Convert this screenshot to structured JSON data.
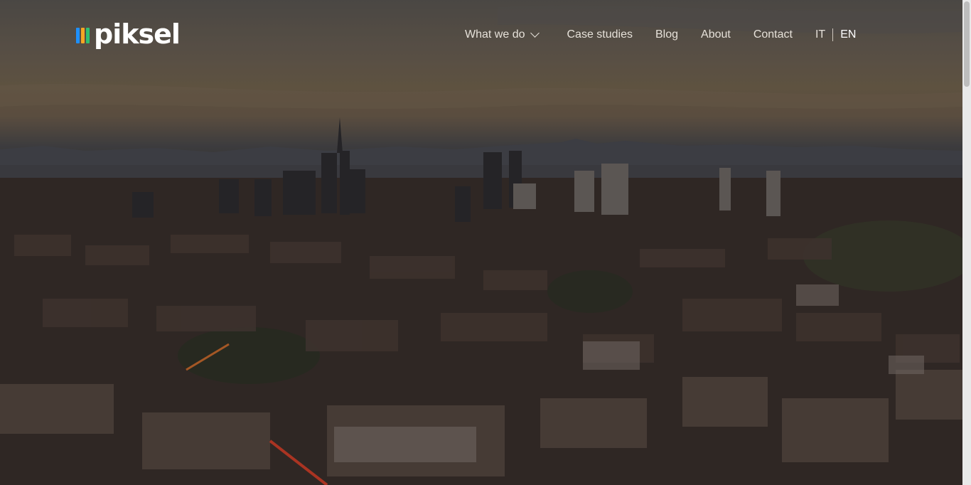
{
  "brand": {
    "name": "piksel",
    "mark_colors": [
      "#1e90ff",
      "#f5a623",
      "#2fbf71"
    ]
  },
  "nav": {
    "items": [
      {
        "label": "What we do",
        "has_dropdown": true,
        "icon": "chevron-down-icon"
      },
      {
        "label": "Case studies"
      },
      {
        "label": "Blog"
      },
      {
        "label": "About"
      },
      {
        "label": "Contact"
      }
    ],
    "languages": {
      "options": [
        "IT",
        "EN"
      ],
      "active": "EN"
    }
  },
  "hero": {
    "background": "aerial city skyline at dusk with mountains"
  }
}
